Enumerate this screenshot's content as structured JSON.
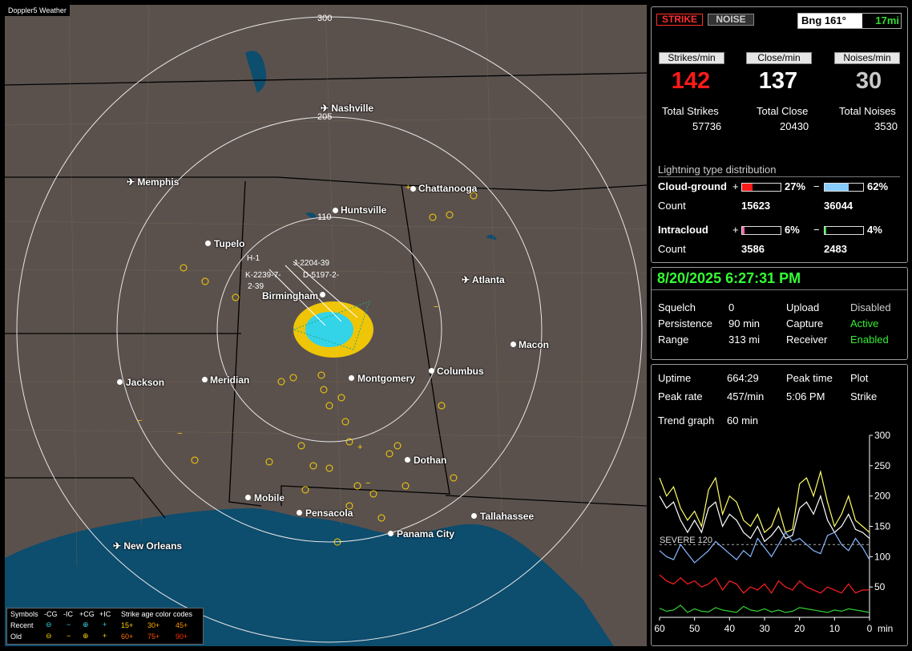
{
  "map": {
    "title": "Doppler5 Weather",
    "ring_labels": [
      "300",
      "205",
      "110"
    ],
    "cities": [
      {
        "name": "Nashville",
        "airport": true
      },
      {
        "name": "Memphis",
        "airport": true
      },
      {
        "name": "Chattanooga",
        "airport": false
      },
      {
        "name": "Huntsville",
        "airport": false
      },
      {
        "name": "Tupelo",
        "airport": false
      },
      {
        "name": "Atlanta",
        "airport": true
      },
      {
        "name": "Birmingham",
        "airport": false
      },
      {
        "name": "Macon",
        "airport": false
      },
      {
        "name": "Jackson",
        "airport": false
      },
      {
        "name": "Meridian",
        "airport": false
      },
      {
        "name": "Montgomery",
        "airport": false
      },
      {
        "name": "Columbus",
        "airport": false
      },
      {
        "name": "Dothan",
        "airport": false
      },
      {
        "name": "Mobile",
        "airport": false
      },
      {
        "name": "Pensacola",
        "airport": false
      },
      {
        "name": "Tallahassee",
        "airport": false
      },
      {
        "name": "Panama City",
        "airport": false
      },
      {
        "name": "New Orleans",
        "airport": true
      }
    ],
    "storm_labels": [
      "H-1",
      "K-2239-7-",
      "D-5197-2-",
      "2-39",
      "J-2204-39"
    ],
    "legend": {
      "symbols_label": "Symbols",
      "headers": [
        "-CG",
        "-IC",
        "+CG",
        "+IC"
      ],
      "recent_label": "Recent",
      "old_label": "Old",
      "age_title": "Strike age color codes",
      "recent_ages": [
        "15+",
        "30+",
        "45+"
      ],
      "old_ages": [
        "60+",
        "75+",
        "90+"
      ]
    }
  },
  "header": {
    "strike_button": "STRIKE",
    "noise_button": "NOISE",
    "bearing": "Bng 161°",
    "distance": "17mi"
  },
  "rates": {
    "strikes_label": "Strikes/min",
    "strikes_value": "142",
    "close_label": "Close/min",
    "close_value": "137",
    "noises_label": "Noises/min",
    "noises_value": "30"
  },
  "totals": {
    "strikes_label": "Total Strikes",
    "strikes_value": "57736",
    "close_label": "Total Close",
    "close_value": "20430",
    "noises_label": "Total Noises",
    "noises_value": "3530"
  },
  "distribution": {
    "title": "Lightning type distribution",
    "cg_label": "Cloud-ground",
    "cg_pos_sign": "+",
    "cg_pos_pct": "27%",
    "cg_pos_fraction": 0.27,
    "cg_neg_sign": "−",
    "cg_neg_pct": "62%",
    "cg_neg_fraction": 0.62,
    "count_label": "Count",
    "cg_pos_count": "15623",
    "cg_neg_count": "36044",
    "ic_label": "Intracloud",
    "ic_pos_sign": "+",
    "ic_pos_pct": "6%",
    "ic_pos_fraction": 0.06,
    "ic_neg_sign": "−",
    "ic_neg_pct": "4%",
    "ic_neg_fraction": 0.04,
    "ic_pos_count": "3586",
    "ic_neg_count": "2483"
  },
  "status": {
    "datetime": "8/20/2025 6:27:31 PM",
    "squelch_label": "Squelch",
    "squelch_value": "0",
    "persistence_label": "Persistence",
    "persistence_value": "90 min",
    "range_label": "Range",
    "range_value": "313 mi",
    "upload_label": "Upload",
    "upload_value": "Disabled",
    "capture_label": "Capture",
    "capture_value": "Active",
    "receiver_label": "Receiver",
    "receiver_value": "Enabled"
  },
  "trend": {
    "uptime_label": "Uptime",
    "uptime_value": "664:29",
    "peak_time_label": "Peak time",
    "peak_time_value": "5:06 PM",
    "plot_label": "Plot",
    "plot_value": "Strike",
    "peak_rate_label": "Peak rate",
    "peak_rate_value": "457/min",
    "trend_label": "Trend graph",
    "trend_value": "60 min",
    "severe_label": "SEVERE 120"
  },
  "chart_data": {
    "type": "line",
    "x": [
      60,
      58,
      56,
      54,
      52,
      50,
      48,
      46,
      44,
      42,
      40,
      38,
      36,
      34,
      32,
      30,
      28,
      26,
      24,
      22,
      20,
      18,
      16,
      14,
      12,
      10,
      8,
      6,
      4,
      2,
      0
    ],
    "xlabel": "min",
    "x_ticks": [
      "60",
      "50",
      "40",
      "30",
      "20",
      "10",
      "0"
    ],
    "y_ticks": [
      "300",
      "250",
      "200",
      "150",
      "100",
      "50"
    ],
    "ylim": [
      0,
      300
    ],
    "severe_threshold": 120,
    "colors": {
      "total": "#ffff66",
      "close": "#ffffff",
      "ic": "#88b8ff",
      "cg": "#ff2020",
      "noise": "#33cc33"
    },
    "series": [
      {
        "key": "total",
        "values": [
          230,
          200,
          215,
          180,
          160,
          175,
          150,
          210,
          230,
          170,
          200,
          190,
          160,
          150,
          170,
          140,
          150,
          180,
          140,
          145,
          220,
          230,
          200,
          240,
          190,
          150,
          170,
          200,
          160,
          150,
          140
        ]
      },
      {
        "key": "close",
        "values": [
          200,
          180,
          190,
          160,
          140,
          160,
          140,
          180,
          190,
          150,
          170,
          160,
          140,
          130,
          150,
          125,
          135,
          150,
          130,
          135,
          180,
          190,
          170,
          200,
          160,
          140,
          150,
          170,
          145,
          140,
          130
        ]
      },
      {
        "key": "ic",
        "values": [
          110,
          100,
          95,
          120,
          105,
          90,
          100,
          110,
          125,
          115,
          105,
          95,
          110,
          100,
          130,
          115,
          100,
          120,
          140,
          125,
          130,
          120,
          110,
          105,
          135,
          140,
          120,
          110,
          130,
          115,
          95
        ]
      },
      {
        "key": "cg",
        "values": [
          70,
          60,
          55,
          65,
          55,
          60,
          50,
          55,
          65,
          45,
          60,
          55,
          40,
          50,
          45,
          55,
          40,
          60,
          50,
          45,
          60,
          50,
          45,
          40,
          50,
          45,
          40,
          55,
          40,
          45,
          45
        ]
      },
      {
        "key": "noise",
        "values": [
          15,
          10,
          12,
          20,
          8,
          14,
          10,
          9,
          16,
          12,
          10,
          8,
          18,
          12,
          10,
          14,
          9,
          12,
          8,
          10,
          16,
          14,
          12,
          10,
          8,
          12,
          10,
          14,
          12,
          10,
          8
        ]
      }
    ]
  }
}
